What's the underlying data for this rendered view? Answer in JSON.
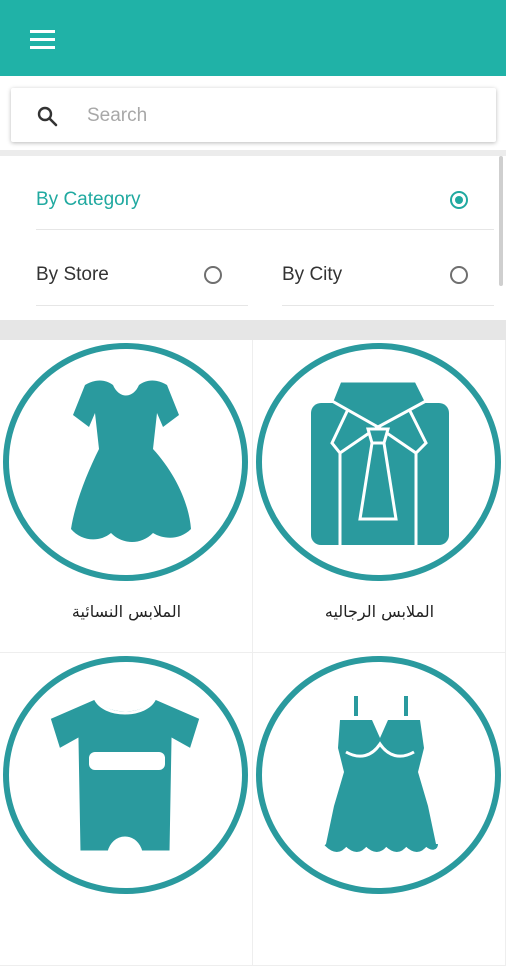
{
  "colors": {
    "accent": "#20b2a7",
    "icon": "#2a9a9e",
    "selected_text": "#20a9a0"
  },
  "appbar": {
    "menu_icon": "hamburger-menu-icon"
  },
  "search": {
    "placeholder": "Search",
    "value": "",
    "icon": "search-icon"
  },
  "filters": {
    "by_category": {
      "label": "By Category",
      "selected": true
    },
    "by_store": {
      "label": "By Store",
      "selected": false
    },
    "by_city": {
      "label": "By City",
      "selected": false
    }
  },
  "categories": [
    {
      "label": "الملابس الرجاليه",
      "icon": "men-shirt-icon"
    },
    {
      "label": "الملابس النسائية",
      "icon": "women-dress-icon"
    },
    {
      "label": "",
      "icon": "lingerie-icon"
    },
    {
      "label": "",
      "icon": "baby-romper-icon"
    }
  ]
}
